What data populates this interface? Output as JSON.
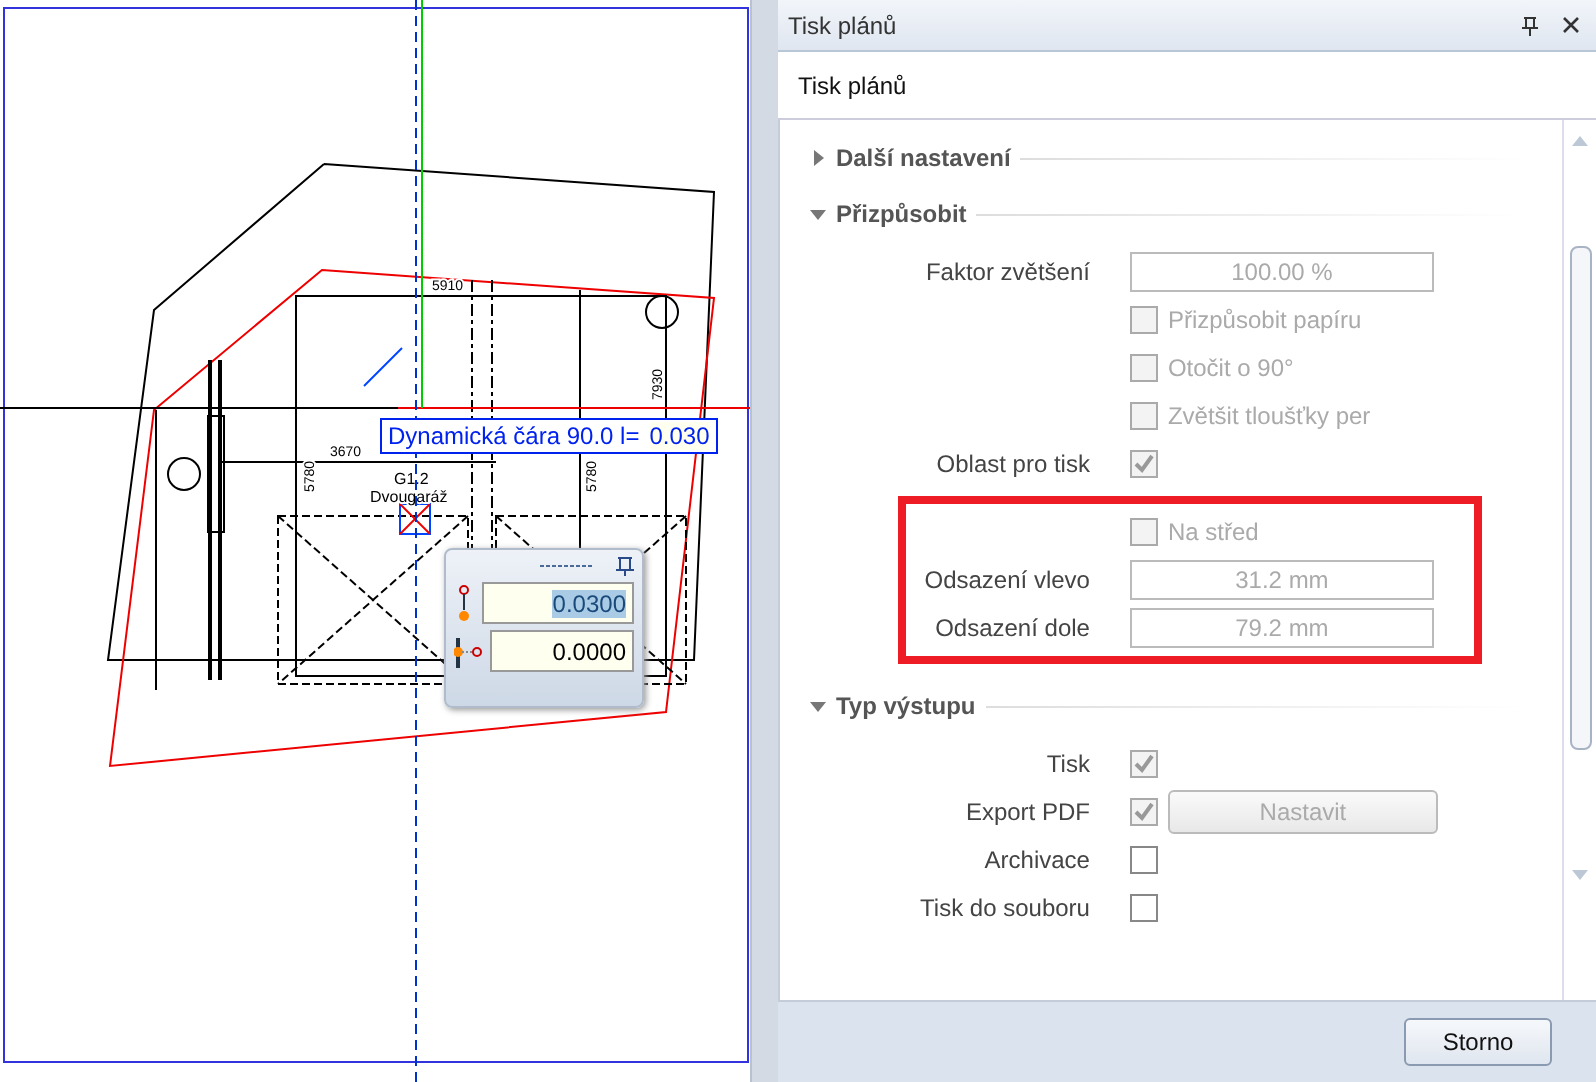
{
  "canvas": {
    "drawing_labels": [
      "5910",
      "3670",
      "5780",
      "5780",
      "7930",
      "G1.2",
      "Dvougaráž"
    ],
    "tooltip": {
      "label": "Dynamická čára 90.0  l=",
      "value": "0.030"
    },
    "input_panel": {
      "fields": [
        {
          "value": "0.0300",
          "selected": true
        },
        {
          "value": "0.0000",
          "selected": false
        }
      ]
    }
  },
  "panel": {
    "title": "Tisk plánů",
    "subtitle": "Tisk plánů",
    "sections": [
      {
        "title": "Další nastavení",
        "expanded": false
      },
      {
        "title": "Přizpůsobit",
        "expanded": true,
        "rows": [
          {
            "kind": "field",
            "label": "Faktor zvětšení",
            "value": "100.00 %",
            "disabled": true,
            "highlighted": false
          },
          {
            "kind": "check-right",
            "label": "Přizpůsobit papíru",
            "checked": false,
            "disabled": true,
            "highlighted": false
          },
          {
            "kind": "check-right",
            "label": "Otočit o 90°",
            "checked": false,
            "disabled": true,
            "highlighted": false
          },
          {
            "kind": "check-right",
            "label": "Zvětšit tloušťky per",
            "checked": false,
            "disabled": true,
            "highlighted": false
          },
          {
            "kind": "check-left",
            "label": "Oblast pro tisk",
            "checked": true,
            "disabled": true,
            "highlighted": false
          },
          {
            "kind": "check-right",
            "label": "Na střed",
            "checked": false,
            "disabled": true,
            "highlighted": true
          },
          {
            "kind": "field",
            "label": "Odsazení vlevo",
            "value": "31.2 mm",
            "disabled": true,
            "highlighted": true
          },
          {
            "kind": "field",
            "label": "Odsazení dole",
            "value": "79.2 mm",
            "disabled": true,
            "highlighted": true
          }
        ]
      },
      {
        "title": "Typ výstupu",
        "expanded": true,
        "rows": [
          {
            "kind": "check-left",
            "label": "Tisk",
            "checked": true,
            "disabled": true,
            "highlighted": false
          },
          {
            "kind": "check-left",
            "label": "Export PDF",
            "checked": true,
            "disabled": true,
            "highlighted": false,
            "button": "Nastavit"
          },
          {
            "kind": "check-left",
            "label": "Archivace",
            "checked": false,
            "disabled": false,
            "highlighted": false
          },
          {
            "kind": "check-left",
            "label": "Tisk do souboru",
            "checked": false,
            "disabled": false,
            "highlighted": false
          }
        ]
      }
    ],
    "footer_button": "Storno"
  }
}
